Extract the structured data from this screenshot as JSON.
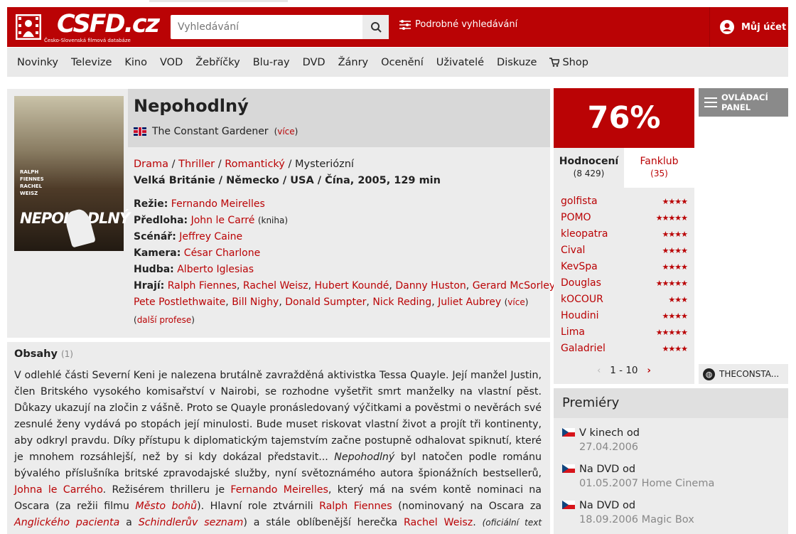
{
  "header": {
    "logo_text": "CSFD.cz",
    "logo_subtitle": "Česko-Slovenská filmová databáze",
    "search_placeholder": "Vyhledávání",
    "advanced_search": "Podrobné vyhledávání",
    "account": "Můj účet"
  },
  "nav": [
    "Novinky",
    "Televize",
    "Kino",
    "VOD",
    "Žebříčky",
    "Blu-ray",
    "DVD",
    "Žánry",
    "Ocenění",
    "Uživatelé",
    "Diskuze",
    "Shop"
  ],
  "film": {
    "title": "Nepohodlný",
    "original_title": "The Constant Gardener",
    "more": "více",
    "genres": [
      "Drama",
      "Thriller",
      "Romantický",
      "Mysteriózní"
    ],
    "origin": "Velká Británie / Německo / USA / Čína, 2005, 129 min",
    "crew": {
      "director_label": "Režie:",
      "director": "Fernando Meirelles",
      "source_label": "Předloha:",
      "source": "John le Carré",
      "source_note": "(kniha)",
      "screenplay_label": "Scénář:",
      "screenplay": "Jeffrey Caine",
      "camera_label": "Kamera:",
      "camera": "César Charlone",
      "music_label": "Hudba:",
      "music": "Alberto Iglesias",
      "cast_label": "Hrají:",
      "cast": [
        "Ralph Fiennes",
        "Rachel Weisz",
        "Hubert Koundé",
        "Danny Huston",
        "Gerard McSorley",
        "Pete Postlethwaite",
        "Bill Nighy",
        "Donald Sumpter",
        "Nick Reding",
        "Juliet Aubrey"
      ],
      "more_cast": "více",
      "more_professions": "další profese"
    },
    "poster": {
      "title": "NEPOHODLNÝ",
      "names": [
        "RALPH",
        "FIENNES",
        "RACHEL",
        "WEISZ"
      ]
    }
  },
  "plot": {
    "heading": "Obsahy",
    "count": "(1)",
    "p1": "V odlehlé části Severní Keni je nalezena brutálně zavražděná aktivistka Tessa Quayle. Její manžel Justin, člen Britského vysokého komisařství v Nairobi, se rozhodne vyšetřit smrt manželky na vlastní pěst. Důkazy ukazují na zločin z vášně. Proto se Quayle pronásledovaný výčitkami a pověstmi o nevěrách své zesnulé ženy vydává po stopách její minulosti. Bude muset riskovat vlastní život a projít tři kontinenty, aby odkryl pravdu. Díky přístupu k diplomatickým tajemstvím začne postupně odhalovat spiknutí, které je mnohem rozsáhlejší, než by si kdy dokázal představit...",
    "film_italic": "Nepohodlný",
    "p2": "byl natočen podle románu bývalého příslušníka britské zpravodajské služby, nyní světoznámého autora špionážních bestsellerů,",
    "author_link": "Johna le Carrého",
    "p3": ". Režisérem thrilleru je",
    "director_link": "Fernando Meirelles",
    "p4": ", který má na svém kontě nominaci na Oscara (za režii filmu",
    "film_link1": "Město bohů",
    "p5": "). Hlavní role ztvárnili",
    "actor_link1": "Ralph Fiennes",
    "p6": "(nominovaný na Oscara za",
    "film_link2": "Anglického pacienta",
    "p7": "a",
    "film_link3": "Schindlerův seznam",
    "p8": ") a stále oblíbenější herečka",
    "actor_link2": "Rachel Weisz",
    "p9": ".",
    "source_note": "(oficiální text distributora)"
  },
  "rating": {
    "value": "76%"
  },
  "tabs": {
    "ratings_label": "Hodnocení",
    "ratings_count": "(8 429)",
    "fanclub_label": "Fanklub",
    "fanclub_count": "(35)"
  },
  "user_ratings": [
    {
      "name": "golfista",
      "stars": "★★★★",
      "rating": 4
    },
    {
      "name": "POMO",
      "stars": "★★★★★",
      "rating": 5
    },
    {
      "name": "kleopatra",
      "stars": "★★★★",
      "rating": 4
    },
    {
      "name": "Cival",
      "stars": "★★★★",
      "rating": 4
    },
    {
      "name": "KevSpa",
      "stars": "★★★★",
      "rating": 4
    },
    {
      "name": "Douglas",
      "stars": "★★★★★",
      "rating": 5
    },
    {
      "name": "kOCOUR",
      "stars": "★★★",
      "rating": 3
    },
    {
      "name": "Houdini",
      "stars": "★★★★",
      "rating": 4
    },
    {
      "name": "Lima",
      "stars": "★★★★★",
      "rating": 5
    },
    {
      "name": "Galadriel",
      "stars": "★★★★",
      "rating": 4
    }
  ],
  "pager": {
    "range": "1 - 10",
    "prev": "‹",
    "next": "›"
  },
  "panel": {
    "label1": "OVLÁDACÍ",
    "label2": "PANEL"
  },
  "globe_link": "THECONSTA...",
  "premieres": {
    "heading": "Premiéry",
    "items": [
      {
        "label": "V kinech od",
        "date": "27.04.2006"
      },
      {
        "label": "Na DVD od",
        "date": "01.05.2007 Home Cinema"
      },
      {
        "label": "Na DVD od",
        "date": "18.09.2006 Magic Box"
      }
    ]
  },
  "colors": {
    "brand": "#ba0305",
    "panel_bg": "#ececec"
  }
}
